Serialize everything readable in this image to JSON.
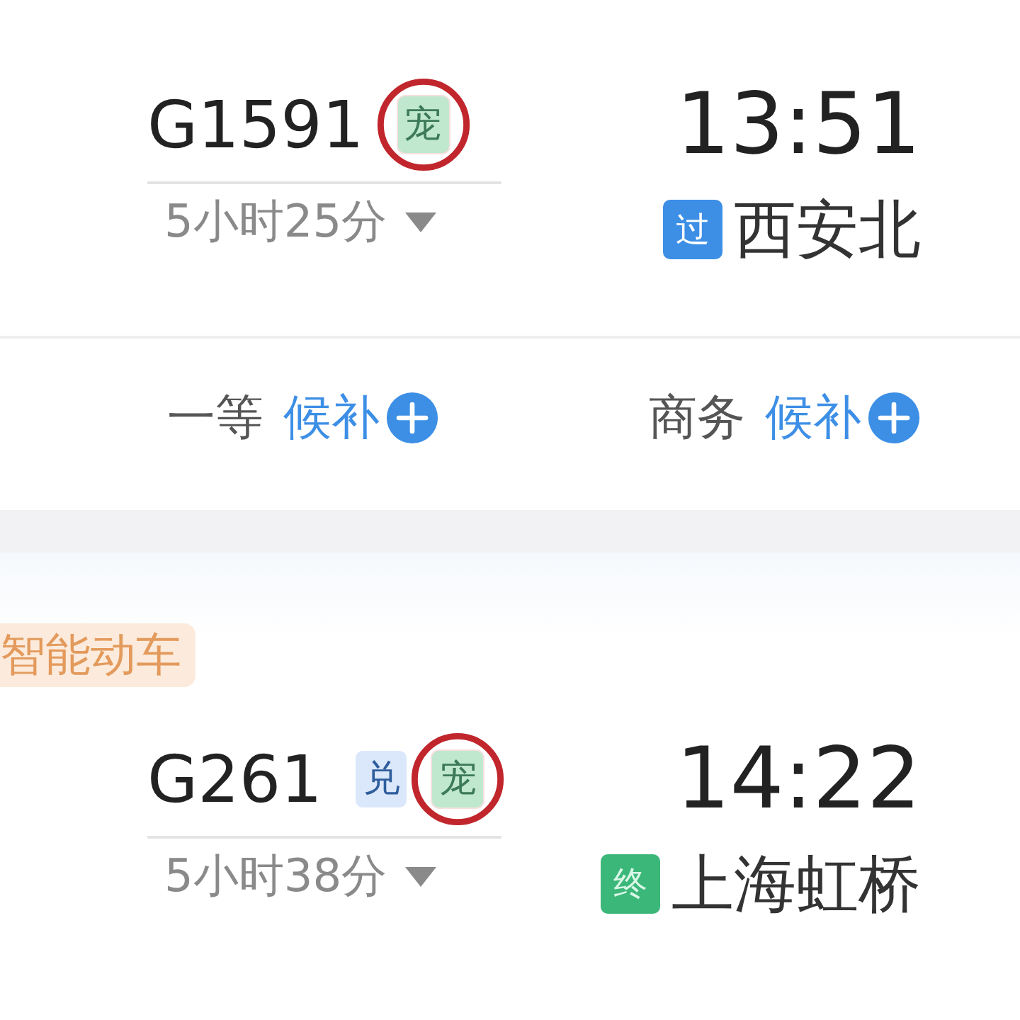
{
  "trains": [
    {
      "number": "G1591",
      "badges": [
        {
          "label": "宠",
          "kind": "pet",
          "circled": true
        }
      ],
      "duration": "5小时25分",
      "arrival_time": "13:51",
      "station_badge": {
        "label": "过",
        "kind": "pass"
      },
      "arrival_station": "西安北",
      "seats": [
        {
          "class": "一等",
          "status": "候补"
        },
        {
          "class": "商务",
          "status": "候补"
        }
      ]
    },
    {
      "tag": "智能动车",
      "number": "G261",
      "badges": [
        {
          "label": "兑",
          "kind": "redeem",
          "circled": false
        },
        {
          "label": "宠",
          "kind": "pet",
          "circled": true
        }
      ],
      "duration": "5小时38分",
      "arrival_time": "14:22",
      "station_badge": {
        "label": "终",
        "kind": "terminal"
      },
      "arrival_station": "上海虹桥"
    }
  ]
}
